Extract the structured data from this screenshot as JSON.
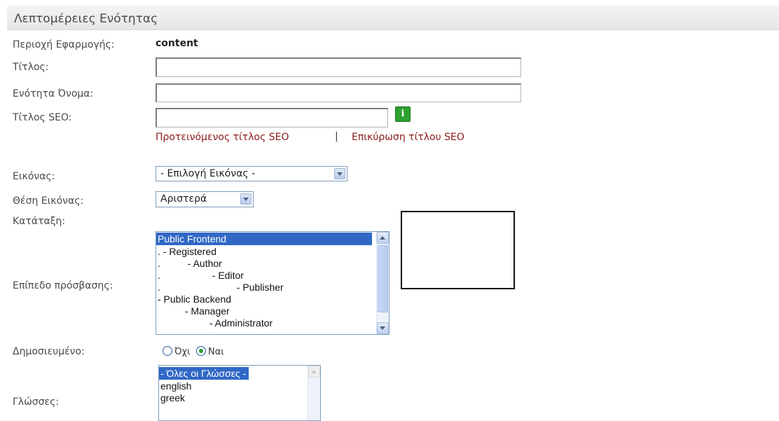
{
  "header": {
    "title": "Λεπτομέρειες Ενότητας"
  },
  "fields": {
    "scope_label": "Περιοχή Εφαρμογής:",
    "scope_value": "content",
    "title_label": "Τίτλος:",
    "title_value": "",
    "name_label": "Ενότητα Όνομα:",
    "name_value": "",
    "seo_title_label": "Τίτλος SEO:",
    "seo_title_value": "",
    "seo_suggest_link": "Προτεινόμενος τίτλος SEO",
    "seo_separator": "|",
    "seo_validate_link": "Επικύρωση τίτλου SEO",
    "image_label": "Εικόνας:",
    "image_selected": "- Επιλογή Εικόνας -",
    "image_position_label": "Θέση Εικόνας:",
    "image_position_selected": "Αριστερά",
    "ordering_label": "Κατάταξη:",
    "access_label": "Επίπεδο πρόσβασης:",
    "access_options": [
      "Public Frontend",
      ". - Registered",
      ".          - Author",
      ".                   - Editor",
      ".                            - Publisher",
      "- Public Backend",
      "          - Manager",
      "                   - Administrator"
    ],
    "published_label": "Δημοσιευμένο:",
    "published_no": "Όχι",
    "published_yes": "Ναι",
    "published_value": "yes",
    "languages_label": "Γλώσσες:",
    "languages_options": [
      "- Όλες οι Γλώσσες -",
      "english",
      "greek"
    ]
  },
  "icons": {
    "info": "info-icon"
  },
  "colors": {
    "link": "#8b1a1a",
    "selection": "#3168c6",
    "info_icon": "#2da12d"
  }
}
